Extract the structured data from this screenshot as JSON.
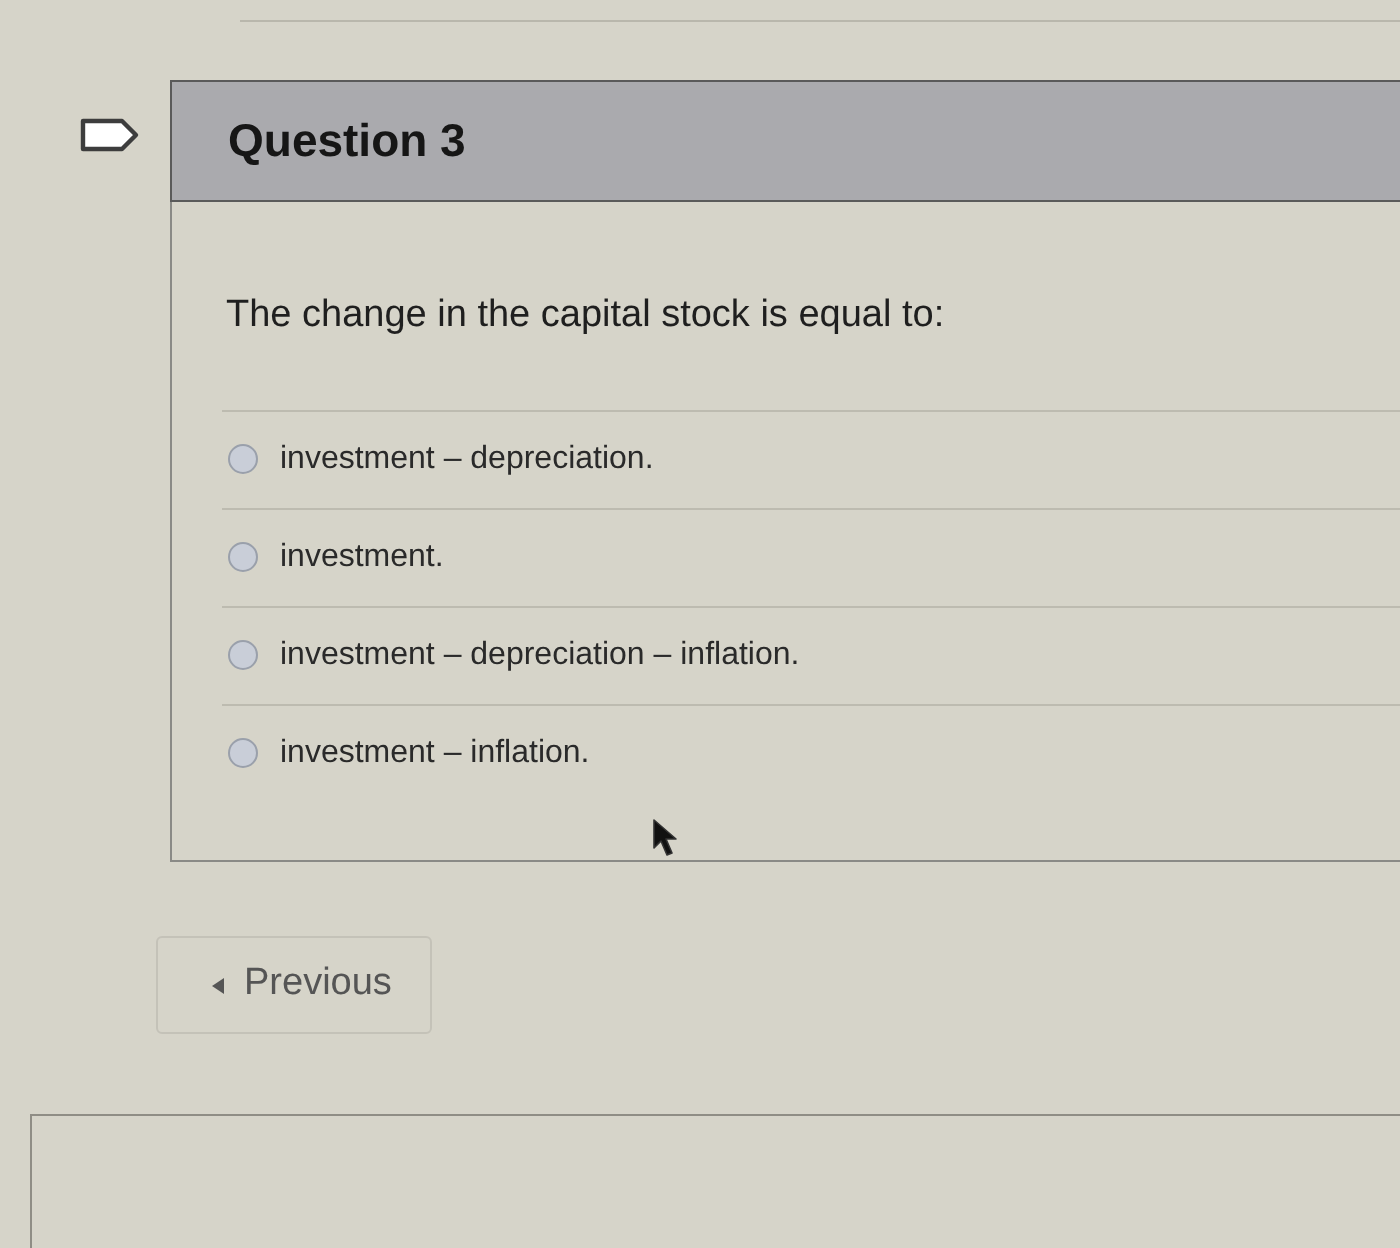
{
  "question": {
    "title": "Question 3",
    "prompt": "The change in the capital stock is equal to:",
    "options": [
      {
        "label": "investment – depreciation.",
        "selected": false
      },
      {
        "label": "investment.",
        "selected": false
      },
      {
        "label": "investment – depreciation – inflation.",
        "selected": false
      },
      {
        "label": "investment – inflation.",
        "selected": false
      }
    ]
  },
  "navigation": {
    "previous": "Previous"
  }
}
